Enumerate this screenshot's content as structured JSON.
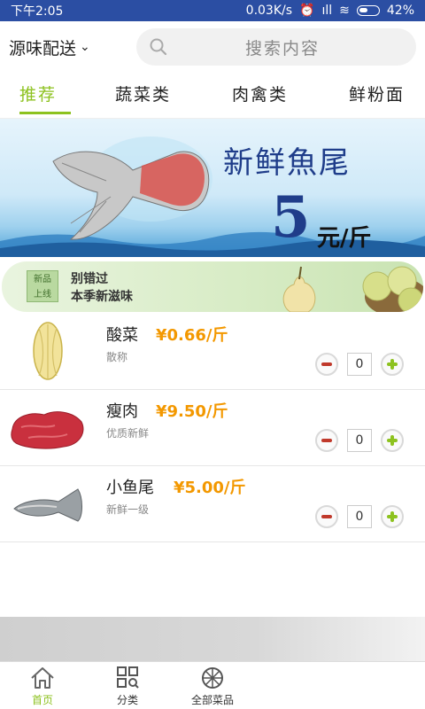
{
  "status_bar": {
    "time": "下午2:05",
    "network_speed": "0.03K/s",
    "signal_indicator": "ıll",
    "battery": "42%"
  },
  "header": {
    "location": "源味配送",
    "search_placeholder": "搜索内容"
  },
  "tabs": [
    {
      "label": "推荐",
      "active": true
    },
    {
      "label": "蔬菜类",
      "active": false
    },
    {
      "label": "肉禽类",
      "active": false
    },
    {
      "label": "鲜粉面",
      "active": false
    }
  ],
  "banner": {
    "title": "新鲜魚尾",
    "price": "5",
    "unit": "元/斤"
  },
  "promo": {
    "badge_line1": "新品",
    "badge_line2": "上线",
    "line1": "别错过",
    "line2": "本季新滋味"
  },
  "products": [
    {
      "name": "酸菜",
      "price": "¥0.66/斤",
      "desc": "散称",
      "qty": "0",
      "icon": "pickled-cabbage-image"
    },
    {
      "name": "瘦肉",
      "price": "¥9.50/斤",
      "desc": "优质新鲜",
      "qty": "0",
      "icon": "lean-pork-image"
    },
    {
      "name": "小鱼尾",
      "price": "¥5.00/斤",
      "desc": "新鲜一级",
      "qty": "0",
      "icon": "fish-tail-image"
    }
  ],
  "bottom_nav": [
    {
      "label": "首页",
      "icon": "home-icon",
      "active": true
    },
    {
      "label": "分类",
      "icon": "category-icon",
      "active": false
    },
    {
      "label": "全部菜品",
      "icon": "all-dishes-icon",
      "active": false
    }
  ],
  "colors": {
    "accent": "#8dc21f",
    "price": "#f39800",
    "status_bar": "#2b4ea3"
  }
}
